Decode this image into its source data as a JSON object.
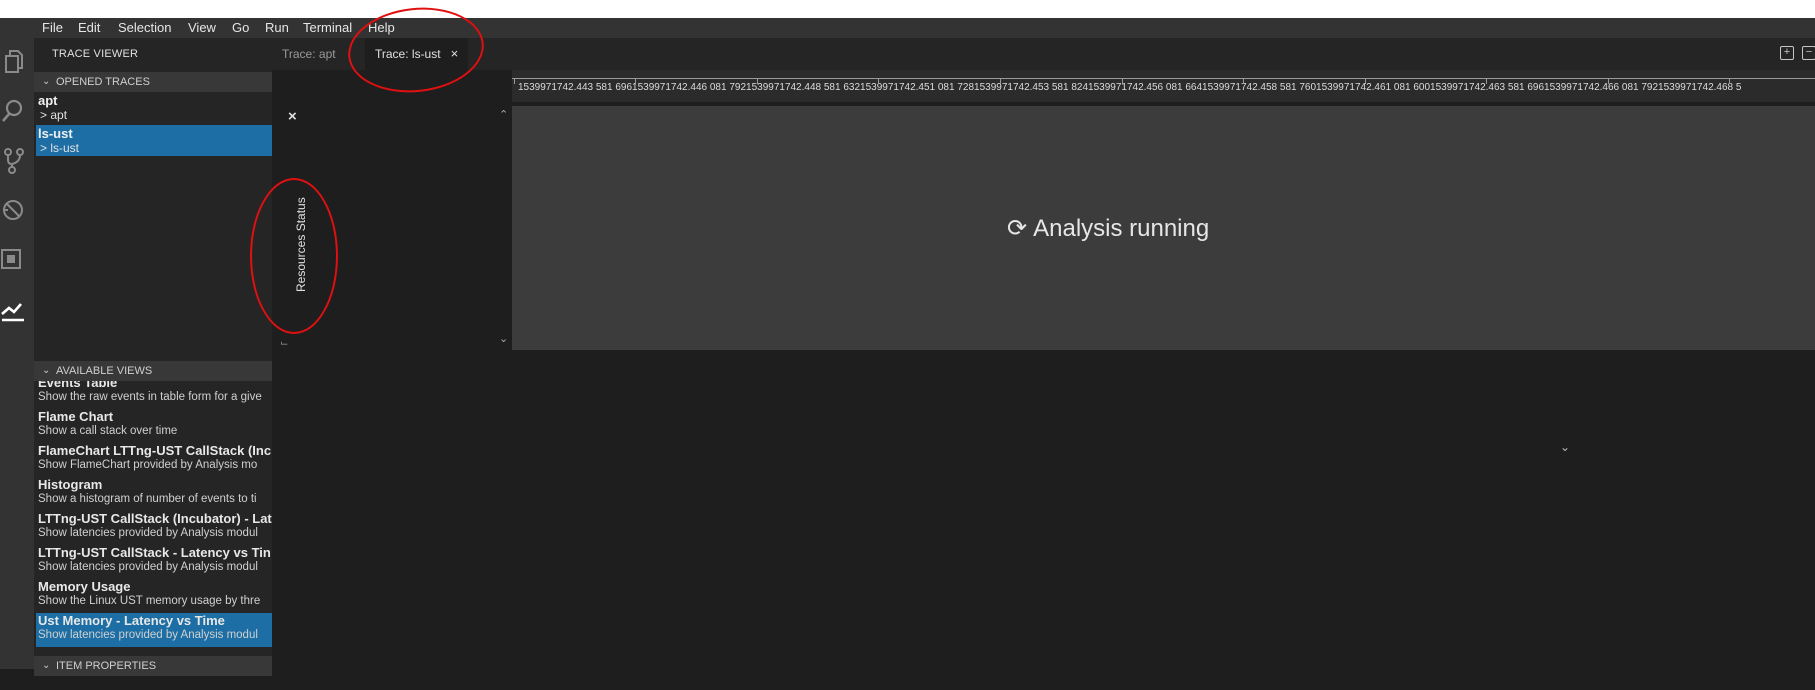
{
  "menu": [
    "File",
    "Edit",
    "Selection",
    "View",
    "Go",
    "Run",
    "Terminal",
    "Help"
  ],
  "activity_icons": [
    "explorer-icon",
    "search-icon",
    "source-control-icon",
    "debug-icon",
    "extensions-icon",
    "trace-viewer-icon"
  ],
  "sidebar": {
    "title": "TRACE VIEWER",
    "opened_traces_header": "OPENED TRACES",
    "traces": [
      {
        "name": "apt",
        "sub": "> apt",
        "selected": false
      },
      {
        "name": "ls-ust",
        "sub": "> ls-ust",
        "selected": true
      }
    ],
    "available_views_header": "AVAILABLE VIEWS",
    "views": [
      {
        "title": "Events Table",
        "desc": "Show the raw events in table form for a give",
        "selected": false
      },
      {
        "title": "Flame Chart",
        "desc": "Show a call stack over time",
        "selected": false
      },
      {
        "title": "FlameChart LTTng-UST CallStack (Inc",
        "desc": "Show FlameChart provided by Analysis mo",
        "selected": false
      },
      {
        "title": "Histogram",
        "desc": "Show a histogram of number of events to ti",
        "selected": false
      },
      {
        "title": "LTTng-UST CallStack (Incubator) - Lat",
        "desc": "Show latencies provided by Analysis modul",
        "selected": false
      },
      {
        "title": "LTTng-UST CallStack - Latency vs Tin",
        "desc": "Show latencies provided by Analysis modul",
        "selected": false
      },
      {
        "title": "Memory Usage",
        "desc": "Show the Linux UST memory usage by thre",
        "selected": false
      },
      {
        "title": "Ust Memory - Latency vs Time",
        "desc": "Show latencies provided by Analysis modul",
        "selected": true
      }
    ],
    "item_properties_header": "ITEM PROPERTIES"
  },
  "tabs": [
    {
      "label": "Trace: apt",
      "active": false
    },
    {
      "label": "Trace: ls-ust",
      "active": true,
      "close": "×"
    }
  ],
  "toolbar": {
    "zoom_in": "+",
    "zoom_out": "−"
  },
  "panel": {
    "close": "×",
    "label": "Resources Status"
  },
  "ruler_text": "1539971742.443 581 6961539971742.446 081 7921539971742.448 581 6321539971742.451 081 7281539971742.453 581 8241539971742.456 081 6641539971742.458 581 7601539971742.461 081 6001539971742.463 581 6961539971742.466 081 7921539971742.468 5",
  "status": {
    "analysis": "Analysis running"
  },
  "colors": {
    "selection": "#1c6ea4",
    "annotation": "#e01010",
    "chart_bg": "#3c3c3c"
  }
}
